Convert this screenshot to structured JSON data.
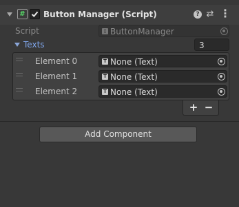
{
  "component": {
    "title": "Button Manager (Script)",
    "enabled": true,
    "help_icon": "help-icon",
    "preset_icon": "presets-icon",
    "menu_icon": "kebab-menu-icon"
  },
  "script_field": {
    "label": "Script",
    "value": "ButtonManager"
  },
  "texts_list": {
    "label": "Texts",
    "count": "3",
    "elements": [
      {
        "label": "Element 0",
        "value": "None (Text)"
      },
      {
        "label": "Element 1",
        "value": "None (Text)"
      },
      {
        "label": "Element 2",
        "value": "None (Text)"
      }
    ],
    "add_label": "+",
    "remove_label": "−"
  },
  "add_component": {
    "label": "Add Component"
  },
  "colors": {
    "background": "#383838",
    "header": "#3e3e3e",
    "field": "#2a2a2a",
    "list_label": "#7fa5ea",
    "script_icon": "#58e06a"
  }
}
